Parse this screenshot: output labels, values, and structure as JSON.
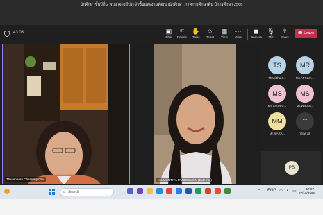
{
  "window": {
    "title": "นักศึกษาชั้นปีที่ 2 พบอาจารย์ประจำชั้นและงานพัฒนานักศึกษา ภาคการศึกษาต้น ปีการศึกษา 2566"
  },
  "meeting": {
    "timer": "43:03"
  },
  "toolbar": [
    {
      "label": "Chat",
      "icon": "chat-icon",
      "glyph": "▣"
    },
    {
      "label": "People",
      "icon": "people-icon",
      "glyph": "👥",
      "count": "97"
    },
    {
      "label": "Raise",
      "icon": "raise-hand-icon",
      "glyph": "✋"
    },
    {
      "label": "React",
      "icon": "react-icon",
      "glyph": "☺"
    },
    {
      "label": "View",
      "icon": "view-icon",
      "glyph": "▦"
    },
    {
      "label": "More",
      "icon": "more-icon",
      "glyph": "···"
    },
    {
      "label": "Camera",
      "icon": "camera-off-icon",
      "glyph": "◼"
    },
    {
      "label": "Mic",
      "icon": "mic-off-icon",
      "glyph": "🎙"
    },
    {
      "label": "Share",
      "icon": "share-icon",
      "glyph": "⇧"
    }
  ],
  "leave": {
    "label": "Leave",
    "color": "#c4314b"
  },
  "tiles": [
    {
      "name": "Thiwaphorn Chalermpichai"
    },
    {
      "name": "Ms.MONTITA PANDEELON (External)"
    }
  ],
  "roster": [
    {
      "initials": "TS",
      "name": "Thanidha S...",
      "color": "#b9d3e6"
    },
    {
      "initials": "MR",
      "name": "Ms.APINYA...",
      "color": "#b9d3e6"
    },
    {
      "initials": "MS",
      "name": "Ms.SIRINAT...",
      "color": "#eec2cf"
    },
    {
      "initials": "MS",
      "name": "Ms.WIRAN...",
      "color": "#eec2cf"
    },
    {
      "initials": "MM",
      "name": "Mr.WARA...",
      "color": "#f3df9e"
    }
  ],
  "view_all": {
    "label": "View all"
  },
  "self_view": {
    "initials": "PS"
  },
  "taskbar": {
    "search_placeholder": "Search",
    "time": "17:07",
    "date": "27/10/2566"
  }
}
